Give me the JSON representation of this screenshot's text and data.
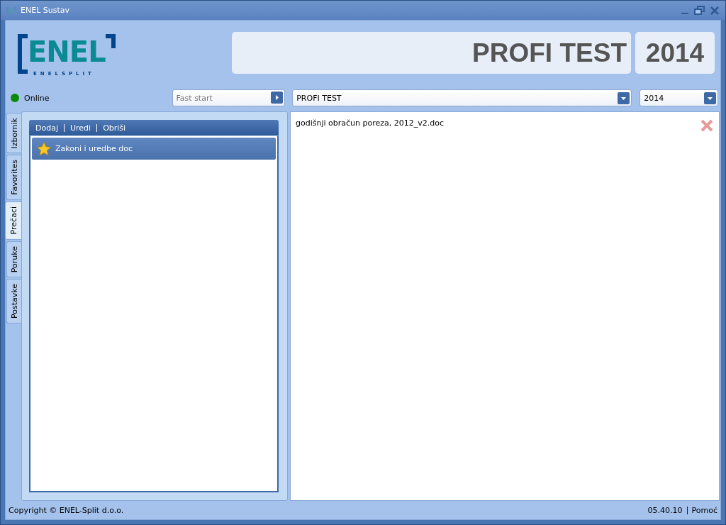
{
  "window": {
    "title": "ENEL Sustav"
  },
  "logo": {
    "text": "ENEL",
    "subtitle": "ENELSPLIT"
  },
  "header": {
    "company": "PROFI TEST",
    "year": "2014"
  },
  "status": {
    "label": "Online",
    "online": true
  },
  "fast_start": {
    "placeholder": "Fast start"
  },
  "company_select": {
    "value": "PROFI TEST"
  },
  "year_select": {
    "value": "2014"
  },
  "side_tabs": [
    {
      "label": "Izbornik",
      "selected": false
    },
    {
      "label": "Favorites",
      "selected": false
    },
    {
      "label": "Prečaci",
      "selected": true
    },
    {
      "label": "Poruke",
      "selected": false
    },
    {
      "label": "Postavke",
      "selected": false
    }
  ],
  "toolbar": [
    "Dodaj",
    "Uredi",
    "Obriši"
  ],
  "shortcuts": [
    {
      "label": "Zakoni i uredbe doc",
      "selected": true
    }
  ],
  "documents": [
    {
      "name": "godišnji obračun poreza, 2012_v2.doc"
    }
  ],
  "footer": {
    "copyright": "Copyright © ENEL-Split d.o.o.",
    "version": "05.40.10",
    "help": "Pomoć"
  }
}
